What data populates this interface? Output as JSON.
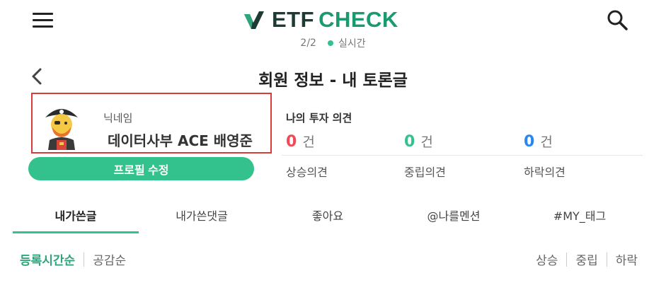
{
  "header": {
    "logo_etf": "ETF",
    "logo_check": "CHECK",
    "page_indicator": "2/2",
    "realtime_label": "실시간"
  },
  "title": "회원 정보 - 내 토론글",
  "profile": {
    "nickname_label": "닉네임",
    "nickname": "데이터사부 ACE 배영준",
    "edit_button": "프로필 수정"
  },
  "opinions": {
    "title": "나의 투자 의견",
    "unit": "건",
    "up": {
      "count": "0",
      "label": "상승의견"
    },
    "neutral": {
      "count": "0",
      "label": "중립의견"
    },
    "down": {
      "count": "0",
      "label": "하락의견"
    }
  },
  "tabs": [
    {
      "label": "내가쓴글",
      "active": true
    },
    {
      "label": "내가쓴댓글",
      "active": false
    },
    {
      "label": "좋아요",
      "active": false
    },
    {
      "label": "@나를멘션",
      "active": false
    },
    {
      "label": "#MY_태그",
      "active": false
    }
  ],
  "sort": {
    "left": [
      "등록시간순",
      "공감순"
    ],
    "right": [
      "상승",
      "중립",
      "하락"
    ]
  },
  "colors": {
    "accent": "#33c18e",
    "up": "#ef4a55",
    "down": "#2b87f0",
    "highlight_box": "#d93b3b"
  },
  "icons": [
    "hamburger-menu-icon",
    "logo-check-icon",
    "search-icon",
    "back-chevron-icon",
    "pirate-avatar-icon"
  ]
}
